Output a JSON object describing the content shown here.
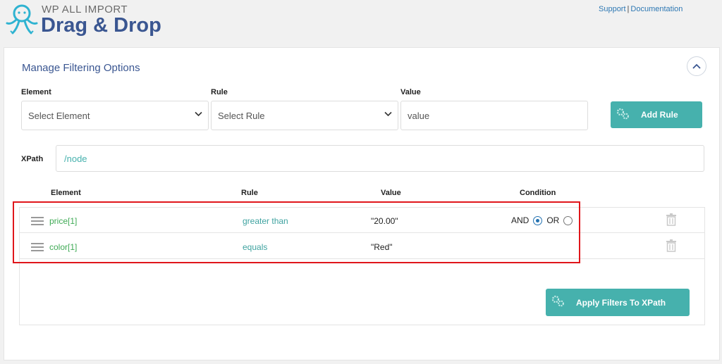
{
  "header": {
    "logo_sub": "WP ALL IMPORT",
    "logo_main": "Drag & Drop",
    "links": [
      "Support",
      "Documentation"
    ],
    "link_separator": "|"
  },
  "panel": {
    "title": "Manage Filtering Options",
    "form": {
      "element_label": "Element",
      "element_placeholder": "Select Element",
      "rule_label": "Rule",
      "rule_placeholder": "Select Rule",
      "value_label": "Value",
      "value_placeholder": "value",
      "add_rule_label": "Add Rule"
    },
    "xpath": {
      "label": "XPath",
      "value": "/node"
    },
    "table": {
      "headers": [
        "Element",
        "Rule",
        "Value",
        "Condition"
      ],
      "rows": [
        {
          "element": "price[1]",
          "rule": "greater than",
          "value": "\"20.00\"",
          "condition": {
            "and_label": "AND",
            "or_label": "OR",
            "selected": "AND"
          }
        },
        {
          "element": "color[1]",
          "rule": "equals",
          "value": "\"Red\""
        }
      ]
    },
    "apply_label": "Apply Filters To XPath"
  },
  "colors": {
    "brand_blue": "#3a5691",
    "teal": "#46b1ad",
    "element_green": "#3faa55",
    "highlight_red": "#e0161b"
  }
}
